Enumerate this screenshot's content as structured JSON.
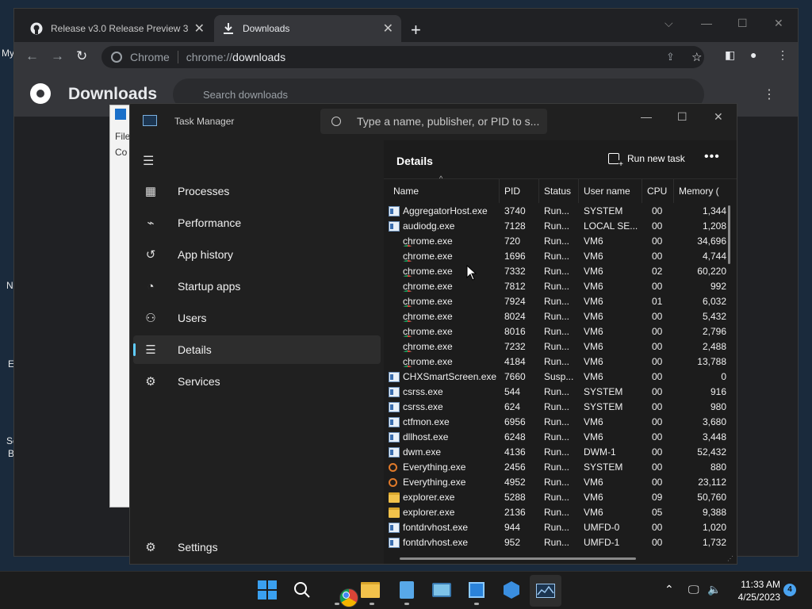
{
  "desktop": {
    "fragments": [
      "My",
      "N",
      "E",
      "Sc",
      "B"
    ]
  },
  "chrome": {
    "tabs": [
      {
        "title": "Release v3.0 Release Preview 3 · ",
        "icon": "github-icon"
      },
      {
        "title": "Downloads",
        "icon": "download-icon"
      }
    ],
    "omnibox": {
      "site": "Chrome",
      "url_scheme": "chrome://",
      "url_host": "downloads"
    },
    "page_title": "Downloads",
    "search_placeholder": "Search downloads"
  },
  "bg_window": {
    "menu_fragment": "File",
    "content_fragment": "Co"
  },
  "task_manager": {
    "title": "Task Manager",
    "search_placeholder": "Type a name, publisher, or PID to s...",
    "nav": [
      {
        "label": "Processes",
        "icon": "processes-icon"
      },
      {
        "label": "Performance",
        "icon": "performance-icon"
      },
      {
        "label": "App history",
        "icon": "app-history-icon"
      },
      {
        "label": "Startup apps",
        "icon": "startup-apps-icon"
      },
      {
        "label": "Users",
        "icon": "users-icon"
      },
      {
        "label": "Details",
        "icon": "details-icon"
      },
      {
        "label": "Services",
        "icon": "services-icon"
      }
    ],
    "selected_nav": "Details",
    "settings_label": "Settings",
    "details_title": "Details",
    "run_new_task": "Run new task",
    "columns": [
      "Name",
      "PID",
      "Status",
      "User name",
      "CPU",
      "Memory ("
    ],
    "rows": [
      {
        "icon": "generic",
        "name": "AggregatorHost.exe",
        "pid": "3740",
        "status": "Run...",
        "user": "SYSTEM",
        "cpu": "00",
        "mem": "1,344"
      },
      {
        "icon": "generic",
        "name": "audiodg.exe",
        "pid": "7128",
        "status": "Run...",
        "user": "LOCAL SE...",
        "cpu": "00",
        "mem": "1,208"
      },
      {
        "icon": "chrome",
        "name": "chrome.exe",
        "pid": "720",
        "status": "Run...",
        "user": "VM6",
        "cpu": "00",
        "mem": "34,696"
      },
      {
        "icon": "chrome",
        "name": "chrome.exe",
        "pid": "1696",
        "status": "Run...",
        "user": "VM6",
        "cpu": "00",
        "mem": "4,744"
      },
      {
        "icon": "chrome",
        "name": "chrome.exe",
        "pid": "7332",
        "status": "Run...",
        "user": "VM6",
        "cpu": "02",
        "mem": "60,220"
      },
      {
        "icon": "chrome",
        "name": "chrome.exe",
        "pid": "7812",
        "status": "Run...",
        "user": "VM6",
        "cpu": "00",
        "mem": "992"
      },
      {
        "icon": "chrome",
        "name": "chrome.exe",
        "pid": "7924",
        "status": "Run...",
        "user": "VM6",
        "cpu": "01",
        "mem": "6,032"
      },
      {
        "icon": "chrome",
        "name": "chrome.exe",
        "pid": "8024",
        "status": "Run...",
        "user": "VM6",
        "cpu": "00",
        "mem": "5,432"
      },
      {
        "icon": "chrome",
        "name": "chrome.exe",
        "pid": "8016",
        "status": "Run...",
        "user": "VM6",
        "cpu": "00",
        "mem": "2,796"
      },
      {
        "icon": "chrome",
        "name": "chrome.exe",
        "pid": "7232",
        "status": "Run...",
        "user": "VM6",
        "cpu": "00",
        "mem": "2,488"
      },
      {
        "icon": "chrome",
        "name": "chrome.exe",
        "pid": "4184",
        "status": "Run...",
        "user": "VM6",
        "cpu": "00",
        "mem": "13,788"
      },
      {
        "icon": "generic",
        "name": "CHXSmartScreen.exe",
        "pid": "7660",
        "status": "Susp...",
        "user": "VM6",
        "cpu": "00",
        "mem": "0"
      },
      {
        "icon": "generic",
        "name": "csrss.exe",
        "pid": "544",
        "status": "Run...",
        "user": "SYSTEM",
        "cpu": "00",
        "mem": "916"
      },
      {
        "icon": "generic",
        "name": "csrss.exe",
        "pid": "624",
        "status": "Run...",
        "user": "SYSTEM",
        "cpu": "00",
        "mem": "980"
      },
      {
        "icon": "generic",
        "name": "ctfmon.exe",
        "pid": "6956",
        "status": "Run...",
        "user": "VM6",
        "cpu": "00",
        "mem": "3,680"
      },
      {
        "icon": "generic",
        "name": "dllhost.exe",
        "pid": "6248",
        "status": "Run...",
        "user": "VM6",
        "cpu": "00",
        "mem": "3,448"
      },
      {
        "icon": "generic",
        "name": "dwm.exe",
        "pid": "4136",
        "status": "Run...",
        "user": "DWM-1",
        "cpu": "00",
        "mem": "52,432"
      },
      {
        "icon": "search",
        "name": "Everything.exe",
        "pid": "2456",
        "status": "Run...",
        "user": "SYSTEM",
        "cpu": "00",
        "mem": "880"
      },
      {
        "icon": "search",
        "name": "Everything.exe",
        "pid": "4952",
        "status": "Run...",
        "user": "VM6",
        "cpu": "00",
        "mem": "23,112"
      },
      {
        "icon": "folder",
        "name": "explorer.exe",
        "pid": "5288",
        "status": "Run...",
        "user": "VM6",
        "cpu": "09",
        "mem": "50,760"
      },
      {
        "icon": "folder",
        "name": "explorer.exe",
        "pid": "2136",
        "status": "Run...",
        "user": "VM6",
        "cpu": "05",
        "mem": "9,388"
      },
      {
        "icon": "generic",
        "name": "fontdrvhost.exe",
        "pid": "944",
        "status": "Run...",
        "user": "UMFD-0",
        "cpu": "00",
        "mem": "1,020"
      },
      {
        "icon": "generic",
        "name": "fontdrvhost.exe",
        "pid": "952",
        "status": "Run...",
        "user": "UMFD-1",
        "cpu": "00",
        "mem": "1,732"
      }
    ]
  },
  "taskbar": {
    "apps": [
      "start-icon",
      "search-icon",
      "chrome-icon",
      "file-explorer-icon",
      "notepad-icon",
      "control-panel-icon",
      "app-icon",
      "network-app-icon",
      "task-manager-icon"
    ],
    "time": "11:33 AM",
    "date": "4/25/2023",
    "notification_count": "4"
  },
  "colors": {
    "accent": "#60cdff",
    "chrome_bg": "#202124",
    "tm_bg": "#202020"
  }
}
